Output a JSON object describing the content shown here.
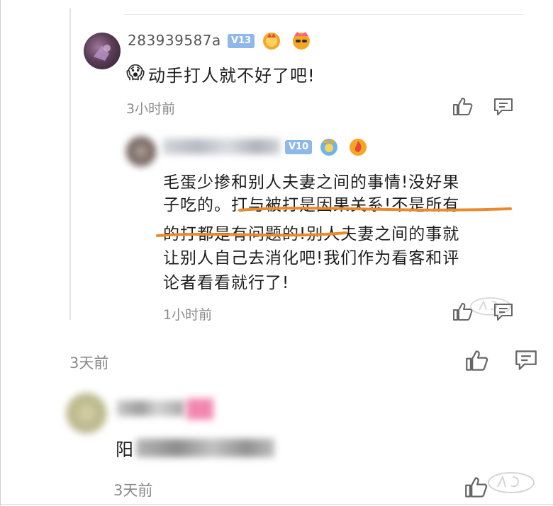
{
  "comment1": {
    "username": "283939587a",
    "level": "V13",
    "emoji": "😱",
    "text": "动手打人就不好了吧!",
    "time": "3小时前"
  },
  "reply1": {
    "level": "V10",
    "lines": [
      "毛蛋少掺和别人夫妻之间的事情!没好果",
      "子吃的。打与被打是因果关系!不是所有",
      "的打都是有问题的!别人夫妻之间的事就",
      "让别人自己去消化吧!我们作为看客和评",
      "论者看看就行了!"
    ],
    "time": "1小时前"
  },
  "parent_footer": {
    "time": "3天前"
  },
  "comment2": {
    "text_visible": "阳",
    "time": "3天前"
  },
  "colors": {
    "underline": "#e98a2c",
    "badge": "#8fb8ea"
  }
}
